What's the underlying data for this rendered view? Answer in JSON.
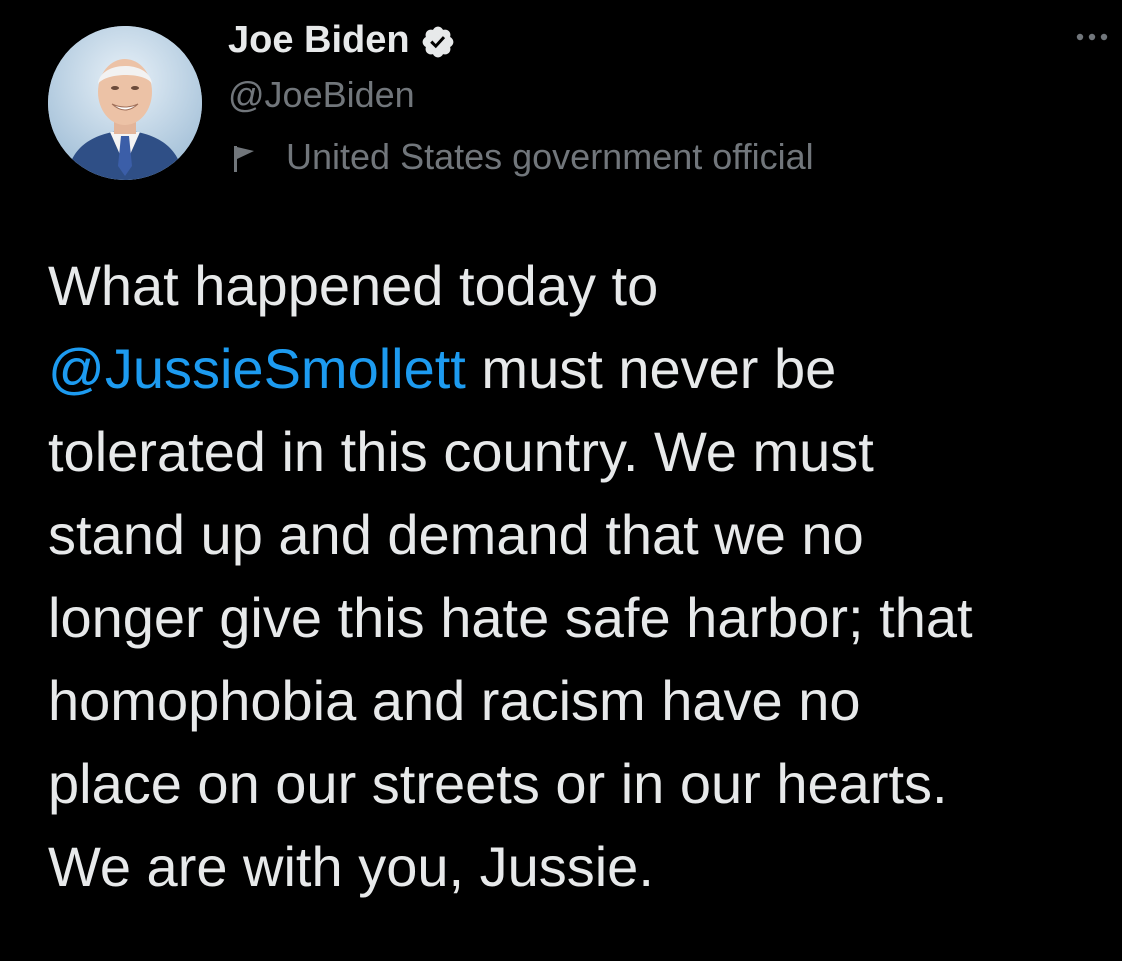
{
  "tweet": {
    "author": {
      "display_name": "Joe Biden",
      "handle": "@JoeBiden",
      "label": "United States government official",
      "verified_icon": "verified-badge-icon",
      "label_icon": "flag-icon"
    },
    "more_icon": "more-options-icon",
    "text_lines": {
      "l1": "What happened today to",
      "l2_mention": "@JussieSmollett",
      "l2_rest": " must never be",
      "l3": "tolerated in this country. We must",
      "l4": "stand up and demand that we no",
      "l5": "longer give this hate safe harbor; that",
      "l6": "homophobia and racism have no",
      "l7": "place on our streets or in our hearts.",
      "l8": "We are with you, Jussie."
    }
  },
  "colors": {
    "background": "#000000",
    "primary_text": "#e7e9ea",
    "secondary_text": "#71767b",
    "mention": "#1d9bf0"
  }
}
